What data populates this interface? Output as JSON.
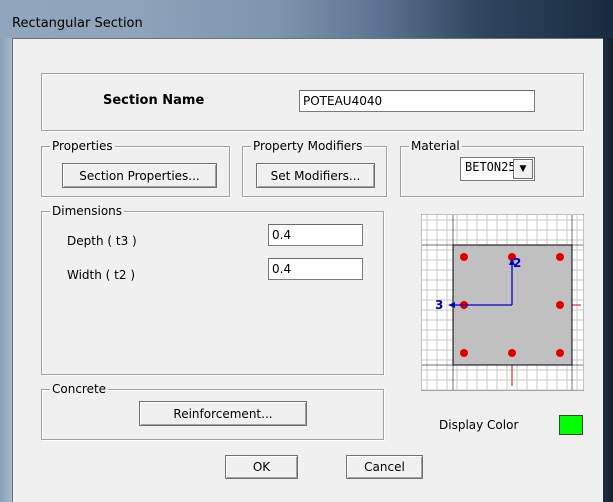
{
  "window": {
    "title": "Rectangular Section"
  },
  "section_name": {
    "label": "Section Name",
    "value": "POTEAU4040"
  },
  "properties": {
    "group_label": "Properties",
    "button_label": "Section Properties..."
  },
  "property_modifiers": {
    "group_label": "Property Modifiers",
    "button_label": "Set Modifiers..."
  },
  "material": {
    "group_label": "Material",
    "selected": "BETON25",
    "arrow": "▼"
  },
  "dimensions": {
    "group_label": "Dimensions",
    "depth_label": "Depth  ( t3 )",
    "depth_value": "0.4",
    "width_label": "Width  ( t2 )",
    "width_value": "0.4"
  },
  "diagram": {
    "axis_vertical_label": "2",
    "axis_horizontal_label": "3",
    "rebar_count": 8
  },
  "concrete": {
    "group_label": "Concrete",
    "button_label": "Reinforcement..."
  },
  "display_color": {
    "label": "Display Color",
    "color": "#00ff00"
  },
  "footer": {
    "ok_label": "OK",
    "cancel_label": "Cancel"
  },
  "colors": {
    "rebar": "#e00000",
    "section_fill": "#c0c0c0",
    "axis": "#0000cc"
  }
}
